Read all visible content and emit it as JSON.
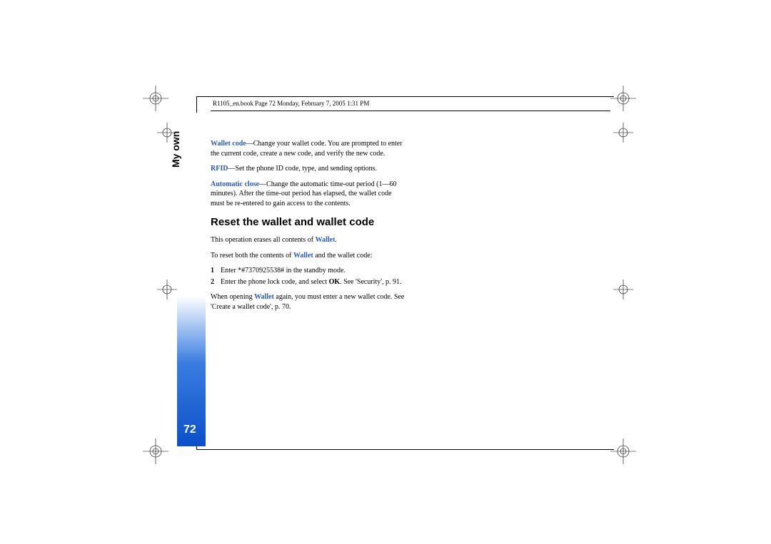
{
  "header": "R1105_en.book  Page 72  Monday, February 7, 2005  1:31 PM",
  "section_title": "My own",
  "page_number": "72",
  "para1": {
    "term": "Wallet code",
    "text": "—Change your wallet code. You are prompted to enter the current code, create a new code, and verify the new code."
  },
  "para2": {
    "term": "RFID",
    "text": "—Set the phone ID code, type, and sending options."
  },
  "para3": {
    "term": "Automatic close",
    "text": "—Change the automatic time-out period (1—60 minutes). After the time-out period has elapsed, the wallet code must be re-entered to gain access to the contents."
  },
  "heading": "Reset the wallet and wallet code",
  "para4": {
    "pre": "This operation erases all contents of ",
    "term": "Wallet",
    "post": "."
  },
  "para5": {
    "pre": "To reset both the contents of ",
    "term": "Wallet",
    "post": " and the wallet code:"
  },
  "steps": [
    {
      "num": "1",
      "text": "Enter *#7370925538# in the standby mode."
    },
    {
      "num": "2",
      "pre": "Enter the phone lock code, and select ",
      "bold": "OK",
      "post": ". See 'Security', p. 91."
    }
  ],
  "para6": {
    "pre": "When opening ",
    "term": "Wallet",
    "post": " again, you must enter a new wallet code. See 'Create a wallet code', p. 70."
  }
}
